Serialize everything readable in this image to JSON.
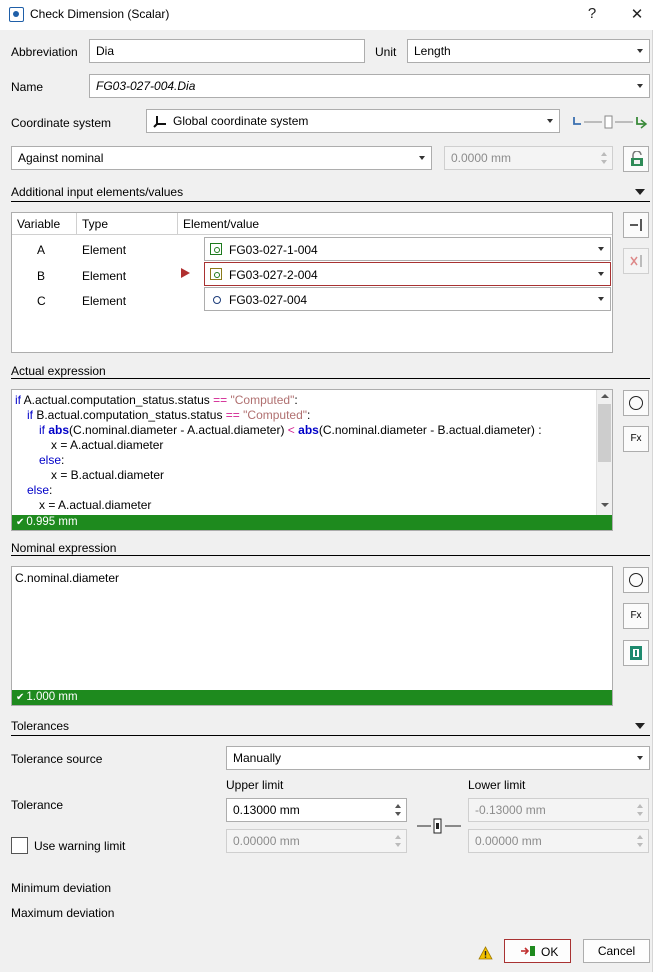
{
  "window": {
    "title": "Check Dimension (Scalar)",
    "help": "?",
    "close": "✕"
  },
  "abbreviation": {
    "label": "Abbreviation",
    "value": "Dia"
  },
  "unit": {
    "label": "Unit",
    "value": "Length"
  },
  "name": {
    "label": "Name",
    "value": "FG03-027-004.Dia"
  },
  "coord": {
    "label": "Coordinate system",
    "value": "Global coordinate system"
  },
  "nominal_mode": {
    "value": "Against nominal",
    "offset": "0.0000 mm"
  },
  "additional": {
    "title": "Additional input elements/values",
    "columns": [
      "Variable",
      "Type",
      "Element/value"
    ],
    "rows": [
      {
        "variable": "A",
        "type": "Element",
        "element": "FG03-027-1-004"
      },
      {
        "variable": "B",
        "type": "Element",
        "element": "FG03-027-2-004"
      },
      {
        "variable": "C",
        "type": "Element",
        "element": "FG03-027-004"
      }
    ]
  },
  "actual": {
    "title": "Actual expression",
    "result": "0.995 mm",
    "fx": "Fx"
  },
  "nominal": {
    "title": "Nominal expression",
    "code": "C.nominal.diameter",
    "result": "1.000 mm",
    "fx": "Fx"
  },
  "tolerances": {
    "title": "Tolerances",
    "source_label": "Tolerance source",
    "source_value": "Manually",
    "upper_label": "Upper limit",
    "lower_label": "Lower limit",
    "tolerance_label": "Tolerance",
    "upper_value": "0.13000 mm",
    "lower_value": "-0.13000 mm",
    "warning_label": "Use warning limit",
    "warn_upper": "0.00000 mm",
    "warn_lower": "0.00000 mm"
  },
  "deviation": {
    "min_label": "Minimum deviation",
    "max_label": "Maximum deviation"
  },
  "buttons": {
    "ok": "OK",
    "cancel": "Cancel"
  }
}
